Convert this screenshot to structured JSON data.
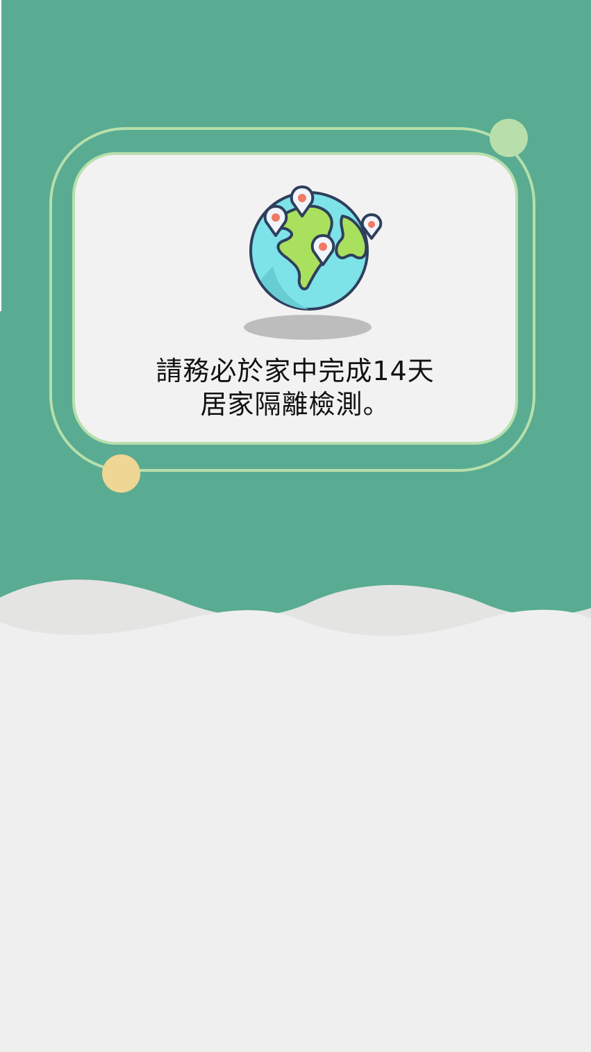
{
  "notice": {
    "line1": "請務必於家中完成14天",
    "line2": "居家隔離檢測。"
  },
  "icons": {
    "globe": "globe-with-location-pins-icon"
  },
  "colors": {
    "background_top": "#59ac91",
    "background_bottom": "#f0efef",
    "card_background": "#f2f2f2",
    "card_border": "#b7dfac",
    "accent_green": "#b8dfab",
    "accent_yellow": "#efd695",
    "globe_ocean": "#7ee3e8",
    "globe_land": "#a9e05d",
    "pin_dot": "#f07a63",
    "outline": "#2e3f5c"
  }
}
